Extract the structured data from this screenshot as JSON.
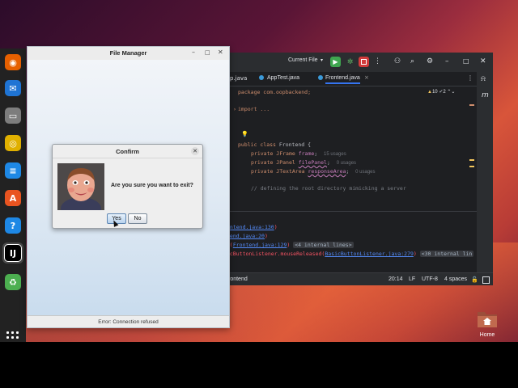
{
  "dock": {
    "items": [
      {
        "name": "firefox-icon",
        "glyph": "◉",
        "color": "#e66000"
      },
      {
        "name": "thunderbird-icon",
        "glyph": "✉",
        "color": "#1f74d4"
      },
      {
        "name": "files-icon",
        "glyph": "▭",
        "color": "#7d7d7d"
      },
      {
        "name": "rhythmbox-icon",
        "glyph": "◎",
        "color": "#e0b000"
      },
      {
        "name": "writer-icon",
        "glyph": "≡",
        "color": "#1e88e5"
      },
      {
        "name": "app-center-icon",
        "glyph": "A",
        "color": "#e95420"
      },
      {
        "name": "help-icon",
        "glyph": "?",
        "color": "#1e88e5"
      },
      {
        "name": "intellij-icon",
        "glyph": "IJ",
        "color": "#000000"
      },
      {
        "name": "trash-icon",
        "glyph": "♻",
        "color": "#4caf50"
      }
    ]
  },
  "ide": {
    "run_config": "Current File",
    "tabs": [
      "p.java",
      "AppTest.java",
      "Frontend.java"
    ],
    "inspections": {
      "warnings": "10",
      "weak": "2"
    },
    "code": {
      "package": "package com.oopbackend;",
      "import": "import ...",
      "class_kw": "public class",
      "class_name": "Frontend {",
      "f1_type": "private JFrame ",
      "f1_name": "frame",
      "f1_hint": "15 usages",
      "f2_type": "private JPanel ",
      "f2_name": "filePanel",
      "f2_hint": "0 usages",
      "f3_type": "private JTextArea ",
      "f3_name": "responseArea",
      "f3_hint": "0 usages",
      "comment": "// defining the root directory mimicking a server"
    },
    "console": [
      {
        "prefix": "",
        "link": "ontend.java:130",
        "suffix": ")"
      },
      {
        "prefix": "",
        "link": "tend.java:20",
        "suffix": ")"
      },
      {
        "prefix": "d(",
        "link": "Frontend.java:129",
        "suffix": ") ",
        "pill": "<4 internal lines>"
      },
      {
        "prefix": "icButtonListener.mouseReleased(",
        "link": "BasicButtonListener.java:279",
        "suffix": ") ",
        "pill": "<30 internal lin"
      }
    ],
    "status": {
      "breadcrumb": "rontend",
      "position": "20:14",
      "line_sep": "LF",
      "encoding": "UTF-8",
      "indent": "4 spaces"
    }
  },
  "file_manager": {
    "title": "File Manager",
    "status": "Error: Connection refused"
  },
  "dialog": {
    "title": "Confirm",
    "message": "Are you sure you want to exit?",
    "yes": "Yes",
    "no": "No"
  },
  "desktop": {
    "home_label": "Home"
  }
}
